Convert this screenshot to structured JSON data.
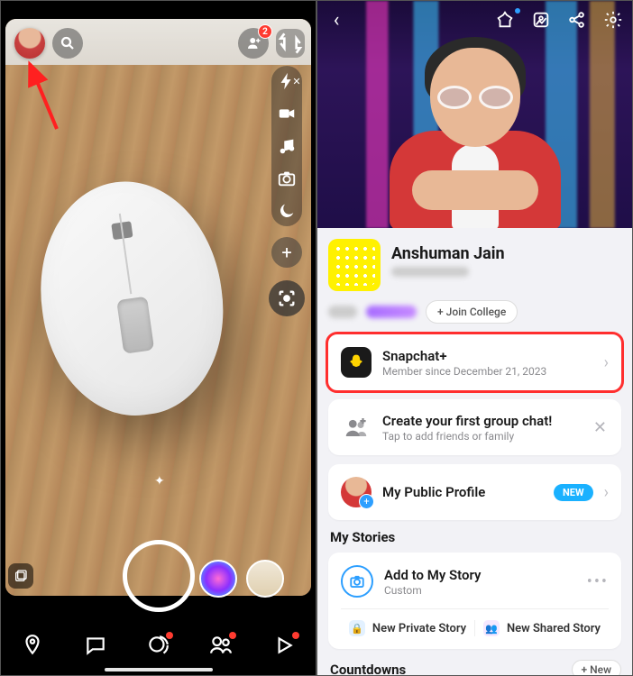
{
  "left": {
    "addFriendBadge": "2",
    "nav": [
      "map",
      "chat",
      "stories",
      "spotlight",
      "play"
    ]
  },
  "right": {
    "displayName": "Anshuman Jain",
    "joinCollege": "+ Join College",
    "snapPlus": {
      "title": "Snapchat+",
      "subtitle": "Member since December 21, 2023"
    },
    "groupChat": {
      "title": "Create your first group chat!",
      "subtitle": "Tap to add friends or family"
    },
    "publicProfile": {
      "title": "My Public Profile",
      "badge": "NEW"
    },
    "stories": {
      "header": "My Stories",
      "add": {
        "title": "Add to My Story",
        "subtitle": "Custom"
      },
      "private": "New Private Story",
      "shared": "New Shared Story"
    },
    "countdowns": {
      "header": "Countdowns",
      "newLabel": "+ New"
    }
  }
}
